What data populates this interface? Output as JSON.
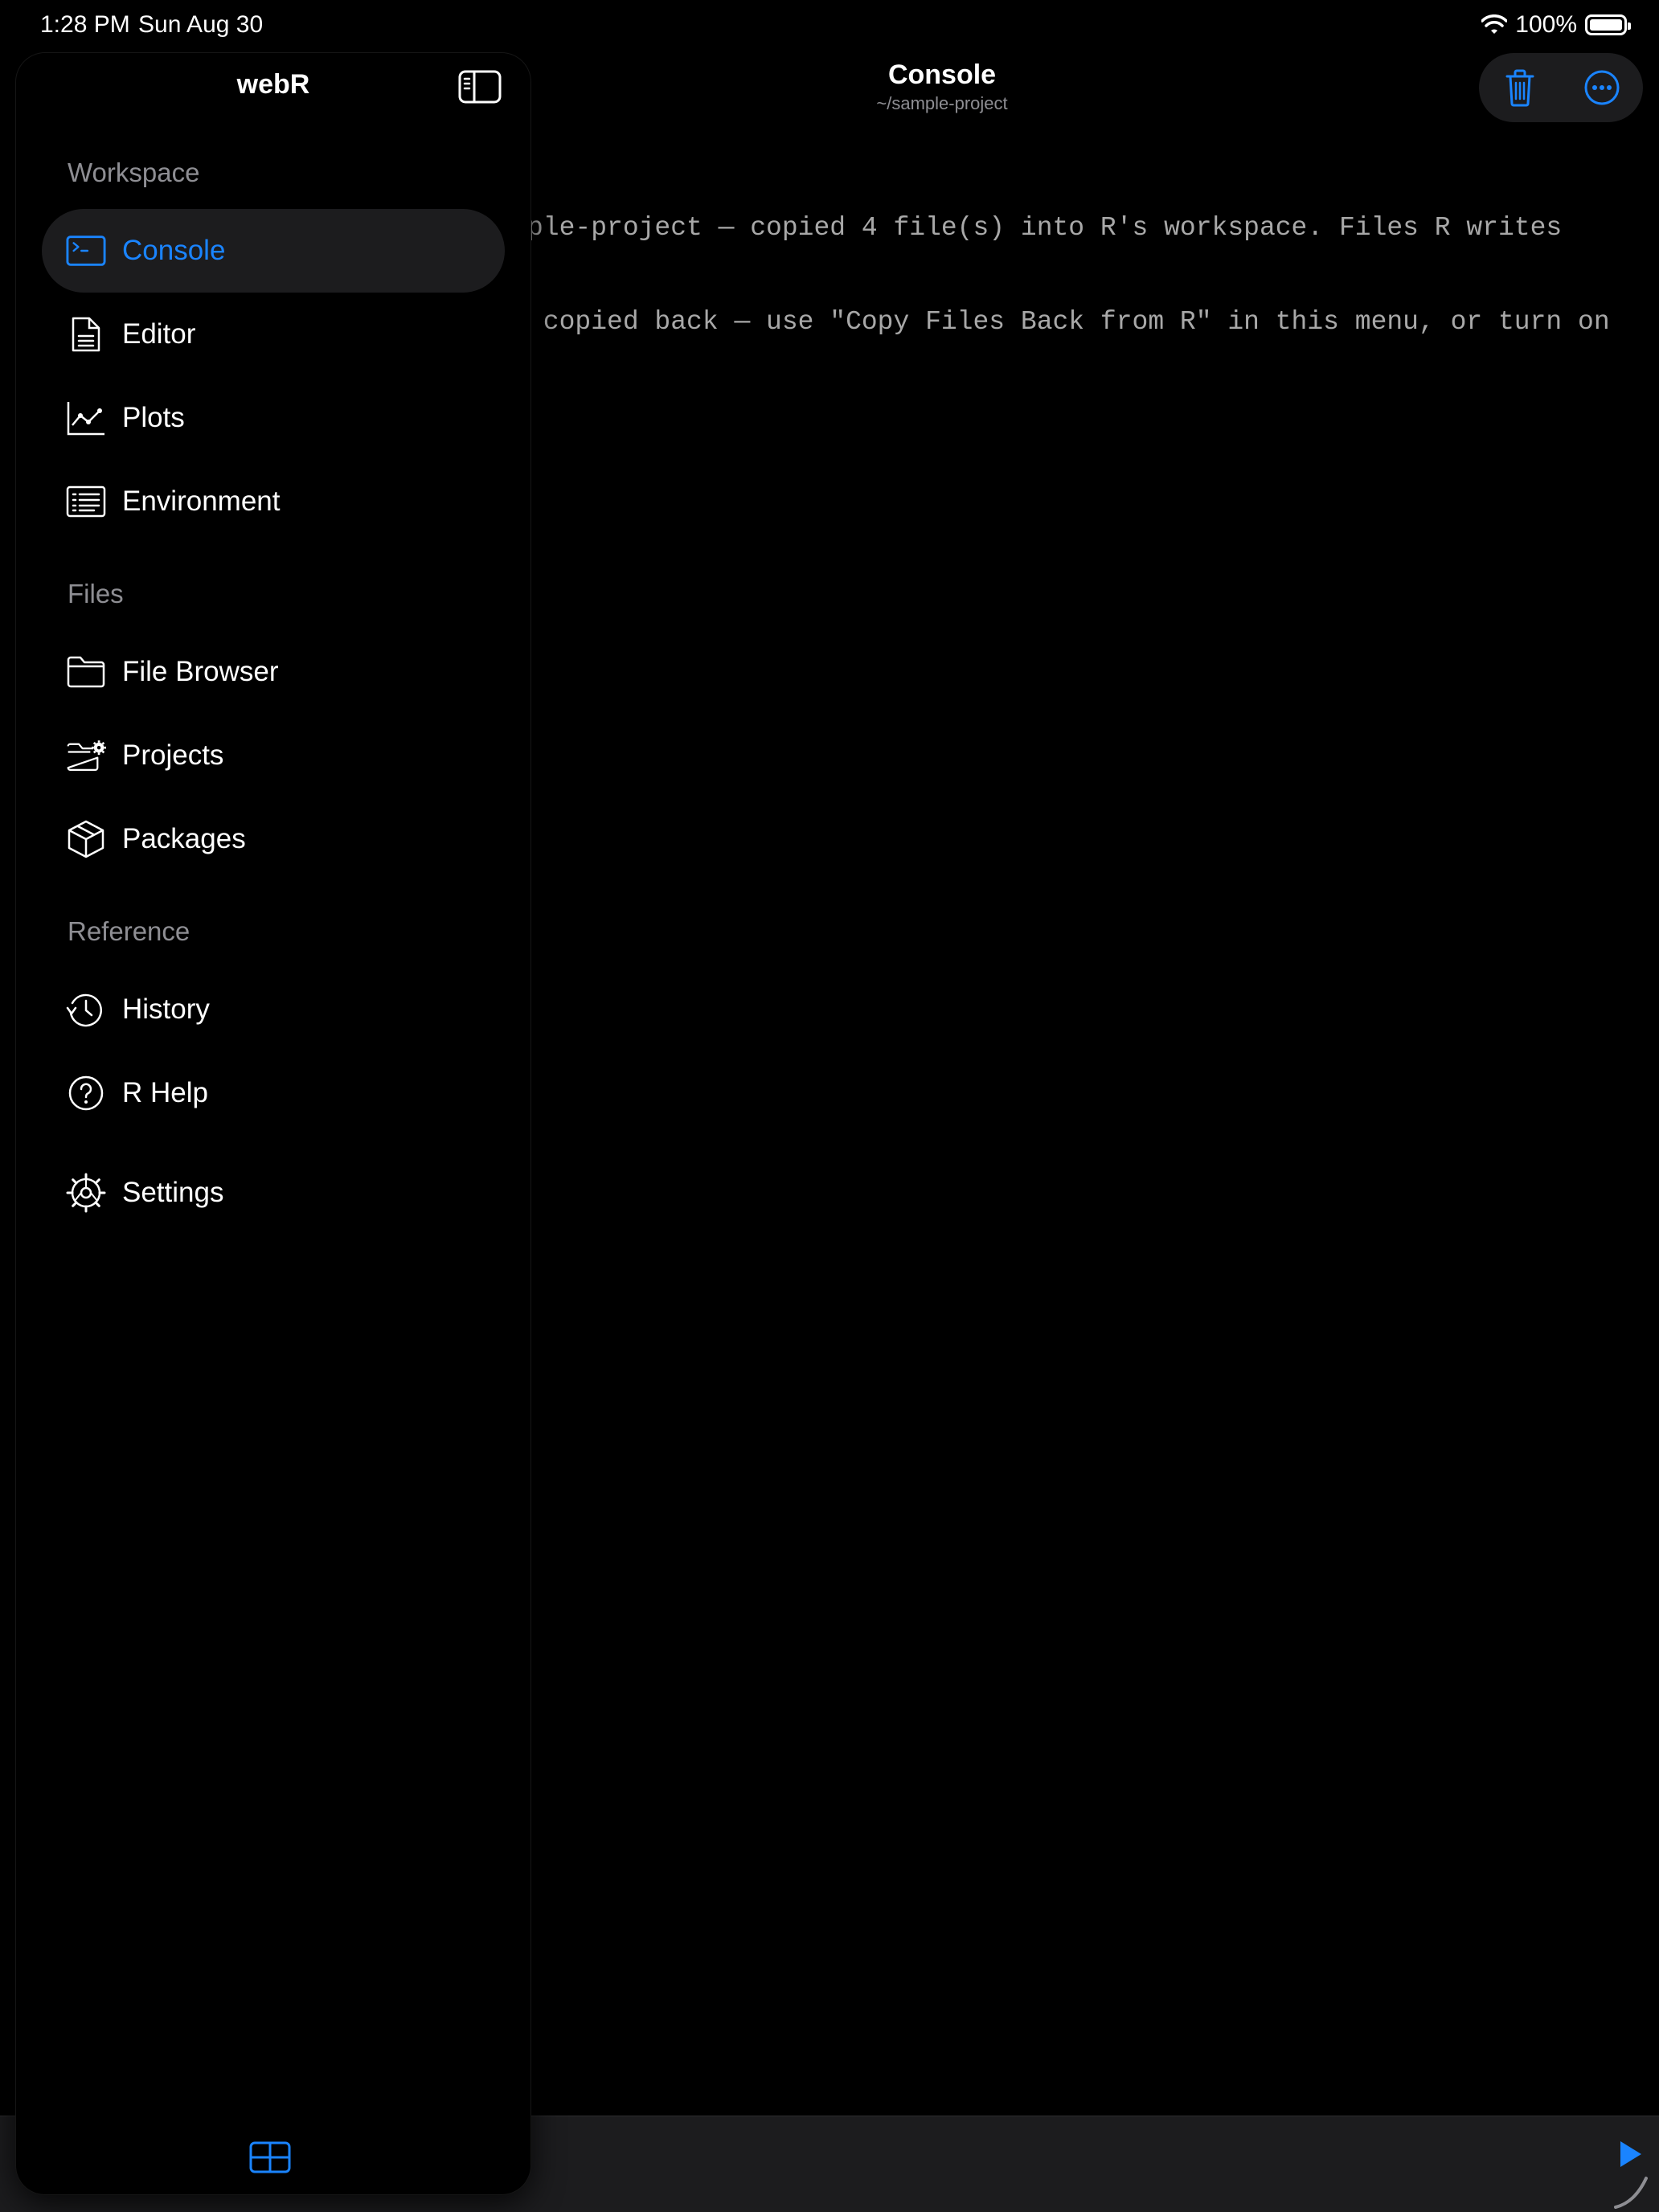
{
  "status_bar": {
    "time": "1:28 PM",
    "date": "Sun Aug 30",
    "battery": "100%",
    "battery_level": 1.0
  },
  "main": {
    "title": "Console",
    "subtitle": "~/sample-project",
    "console_lines": [
      "ple-project — copied 4 file(s) into R's workspace. Files R writes",
      " copied back — use \"Copy Files Back from R\" in this menu, or turn on"
    ]
  },
  "toolbar": {
    "trash_icon": "trash-icon",
    "more_icon": "ellipsis-circle-icon"
  },
  "sidebar": {
    "title": "webR",
    "sections": [
      {
        "header": "Workspace",
        "items": [
          {
            "label": "Console",
            "icon": "terminal-icon",
            "active": true
          },
          {
            "label": "Editor",
            "icon": "document-icon",
            "active": false
          },
          {
            "label": "Plots",
            "icon": "line-chart-icon",
            "active": false
          },
          {
            "label": "Environment",
            "icon": "list-icon",
            "active": false
          }
        ]
      },
      {
        "header": "Files",
        "items": [
          {
            "label": "File Browser",
            "icon": "folder-icon",
            "active": false
          },
          {
            "label": "Projects",
            "icon": "folder-gear-icon",
            "active": false
          },
          {
            "label": "Packages",
            "icon": "package-icon",
            "active": false
          }
        ]
      },
      {
        "header": "Reference",
        "items": [
          {
            "label": "History",
            "icon": "history-icon",
            "active": false
          },
          {
            "label": "R Help",
            "icon": "question-circle-icon",
            "active": false
          }
        ]
      }
    ],
    "settings_label": "Settings"
  },
  "colors": {
    "accent": "#1a84ff",
    "background": "#000000",
    "surface": "#1c1c1e",
    "secondary_text": "#8e8e93"
  }
}
